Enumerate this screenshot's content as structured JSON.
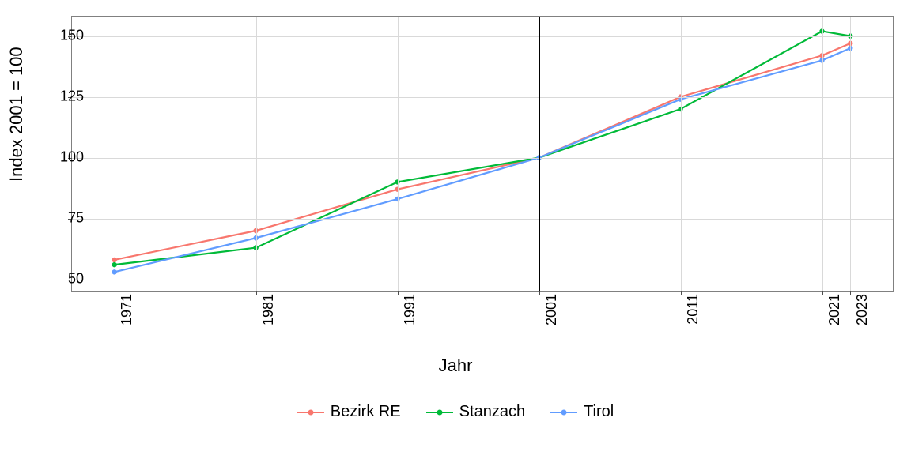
{
  "chart_data": {
    "type": "line",
    "title": "",
    "xlabel": "Jahr",
    "ylabel": "Index 2001 = 100",
    "x": [
      1971,
      1981,
      1991,
      2001,
      2011,
      2021,
      2023
    ],
    "x_ticks": [
      1971,
      1981,
      1991,
      2001,
      2011,
      2021,
      2023
    ],
    "y_ticks": [
      50,
      75,
      100,
      125,
      150
    ],
    "xlim": [
      1968,
      2026
    ],
    "ylim": [
      45,
      158
    ],
    "reference_x": 2001,
    "series": [
      {
        "name": "Bezirk RE",
        "color": "#f8766d",
        "values": [
          58,
          70,
          87,
          100,
          125,
          142,
          147
        ]
      },
      {
        "name": "Stanzach",
        "color": "#00ba38",
        "values": [
          56,
          63,
          90,
          100,
          120,
          152,
          150
        ]
      },
      {
        "name": "Tirol",
        "color": "#619cff",
        "values": [
          53,
          67,
          83,
          100,
          124,
          140,
          145
        ]
      }
    ]
  }
}
